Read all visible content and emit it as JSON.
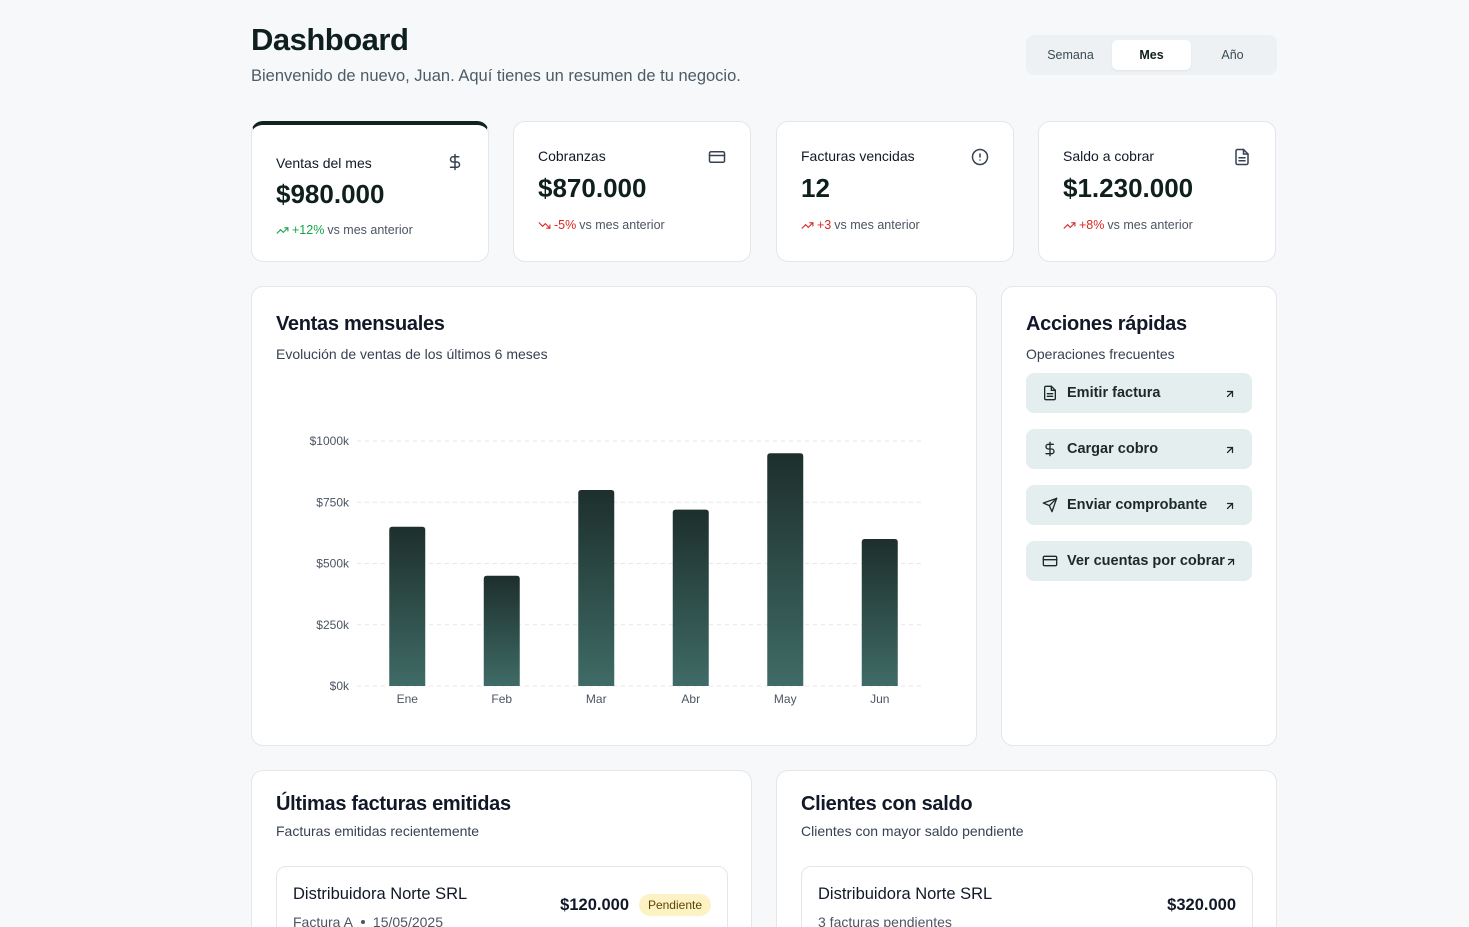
{
  "header": {
    "title": "Dashboard",
    "subtitle": "Bienvenido de nuevo, Juan. Aquí tienes un resumen de tu negocio."
  },
  "period": {
    "options": [
      "Semana",
      "Mes",
      "Año"
    ],
    "selected": "Mes"
  },
  "kpis": [
    {
      "label": "Ventas del mes",
      "value": "$980.000",
      "change": "+12%",
      "change_text": "vs mes anterior",
      "icon": "dollar-icon",
      "trend": "up",
      "change_color": "#16a34a"
    },
    {
      "label": "Cobranzas",
      "value": "$870.000",
      "change": "-5%",
      "change_text": "vs mes anterior",
      "icon": "credit-card-icon",
      "trend": "down",
      "change_color": "#dc2626"
    },
    {
      "label": "Facturas vencidas",
      "value": "12",
      "change": "+3",
      "change_text": "vs mes anterior",
      "icon": "alert-circle-icon",
      "trend": "up",
      "change_color": "#dc2626"
    },
    {
      "label": "Saldo a cobrar",
      "value": "$1.230.000",
      "change": "+8%",
      "change_text": "vs mes anterior",
      "icon": "file-text-icon",
      "trend": "up",
      "change_color": "#dc2626"
    }
  ],
  "sales_chart": {
    "title": "Ventas mensuales",
    "subtitle": "Evolución de ventas de los últimos 6 meses"
  },
  "chart_data": {
    "type": "bar",
    "categories": [
      "Ene",
      "Feb",
      "Mar",
      "Abr",
      "May",
      "Jun"
    ],
    "values": [
      650,
      450,
      800,
      720,
      950,
      600
    ],
    "yticks": [
      "$0k",
      "$250k",
      "$500k",
      "$750k",
      "$1000k"
    ],
    "ylim": [
      0,
      1000
    ],
    "grid": true,
    "bar_color_top": "#1d2f2c",
    "bar_color_bottom": "#3f6b66"
  },
  "quick_actions": {
    "title": "Acciones rápidas",
    "subtitle": "Operaciones frecuentes",
    "items": [
      {
        "label": "Emitir factura",
        "icon": "file-text-icon"
      },
      {
        "label": "Cargar cobro",
        "icon": "dollar-icon"
      },
      {
        "label": "Enviar comprobante",
        "icon": "send-icon"
      },
      {
        "label": "Ver cuentas por cobrar",
        "icon": "credit-card-icon"
      }
    ]
  },
  "invoices": {
    "title": "Últimas facturas emitidas",
    "subtitle": "Facturas emitidas recientemente",
    "rows": [
      {
        "client": "Distribuidora Norte SRL",
        "type": "Factura A",
        "date": "15/05/2025",
        "amount": "$120.000",
        "status": "Pendiente"
      }
    ]
  },
  "clients": {
    "title": "Clientes con saldo",
    "subtitle": "Clientes con mayor saldo pendiente",
    "rows": [
      {
        "client": "Distribuidora Norte SRL",
        "detail": "3 facturas pendientes",
        "amount": "$320.000"
      }
    ]
  }
}
